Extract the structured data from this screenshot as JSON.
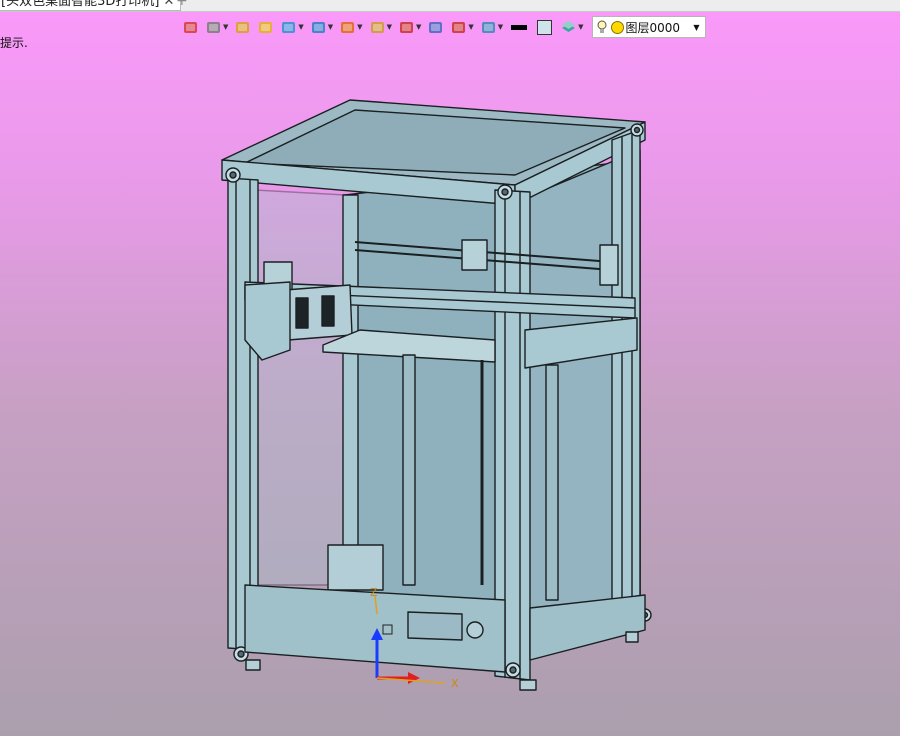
{
  "tab": {
    "title": "[头双色桌面智能3D打印机]",
    "close_glyph": "✕",
    "new_tab_glyph": "+"
  },
  "toolbar": {
    "buttons": [
      {
        "name": "exit-icon",
        "color": "#d43a3a",
        "dropdown": false
      },
      {
        "name": "hand-tool-icon",
        "color": "#7a7a7a",
        "dropdown": true
      },
      {
        "name": "pencil-icon",
        "color": "#d8a020",
        "dropdown": false
      },
      {
        "name": "box-yellow-icon",
        "color": "#e3b21a",
        "dropdown": false
      },
      {
        "name": "cube-blue-icon",
        "color": "#2f8fd2",
        "dropdown": true
      },
      {
        "name": "display-style-icon",
        "color": "#2a7fc8",
        "dropdown": true
      },
      {
        "name": "render-mode-icon",
        "color": "#e06a10",
        "dropdown": true
      },
      {
        "name": "view-orient-icon",
        "color": "#cc9b2c",
        "dropdown": true
      },
      {
        "name": "move-target-icon",
        "color": "#c8322e",
        "dropdown": true
      },
      {
        "name": "frame-icon",
        "color": "#4a66c2",
        "dropdown": false
      },
      {
        "name": "section-icon",
        "color": "#c8322e",
        "dropdown": true
      },
      {
        "name": "monitor-icon",
        "color": "#3a87b8",
        "dropdown": true
      }
    ],
    "linecolor_glyph": "—",
    "layer_name": "图层0000",
    "layer_caret": "▼"
  },
  "status_hint": "提示.",
  "axes": {
    "z": "Z",
    "x": "X"
  },
  "colors": {
    "background_top": "#fb99fb",
    "background_bottom": "#ab9fad",
    "frame": "#a9c9d2",
    "frame_edge": "#1a1f22",
    "panel": "#8fb1be"
  }
}
